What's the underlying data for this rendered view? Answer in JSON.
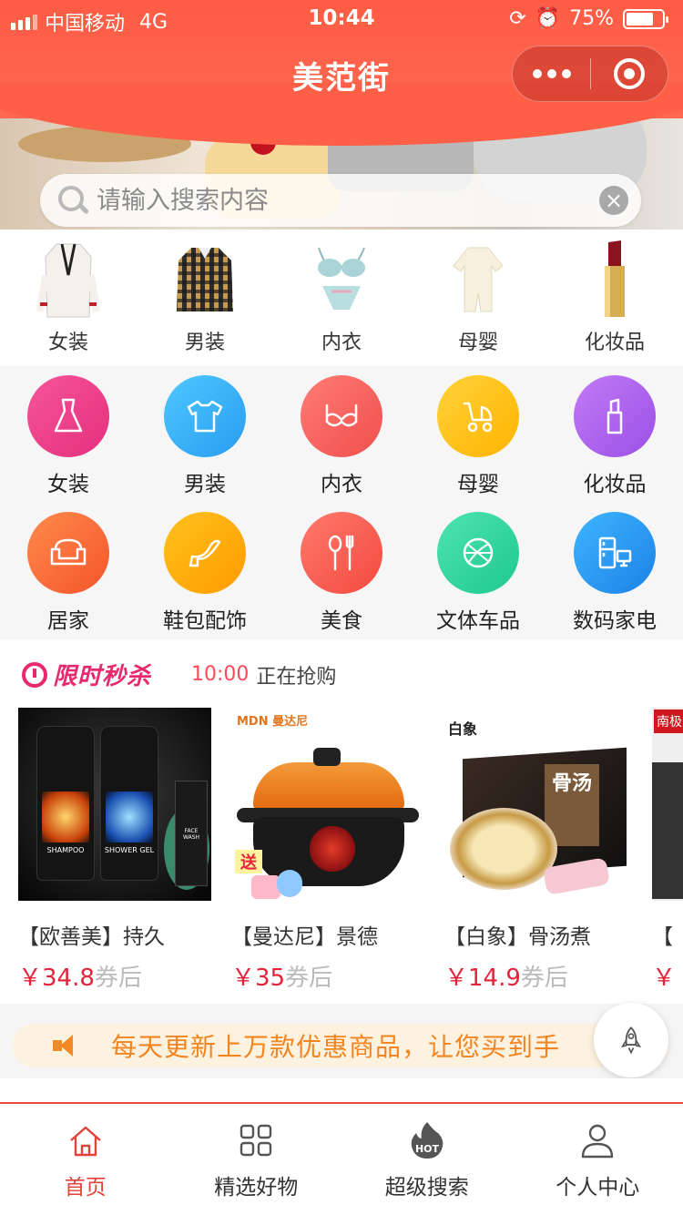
{
  "status_bar": {
    "carrier": "中国移动",
    "network": "4G",
    "time": "10:44",
    "battery": "75%",
    "battery_level": 0.75
  },
  "nav": {
    "title": "美范街"
  },
  "search": {
    "placeholder": "请输入搜索内容"
  },
  "photo_categories": [
    {
      "label": "女装",
      "icon": "coat-photo"
    },
    {
      "label": "男装",
      "icon": "plaid-shirt-photo"
    },
    {
      "label": "内衣",
      "icon": "lingerie-photo"
    },
    {
      "label": "母婴",
      "icon": "baby-romper-photo"
    },
    {
      "label": "化妆品",
      "icon": "lipstick-photo"
    }
  ],
  "icon_categories": [
    {
      "label": "女装",
      "icon": "dress-icon",
      "color_from": "#f6559a",
      "color_to": "#e42f7c"
    },
    {
      "label": "男装",
      "icon": "tshirt-icon",
      "color_from": "#4ec8ff",
      "color_to": "#2a9cf0"
    },
    {
      "label": "内衣",
      "icon": "bra-icon",
      "color_from": "#ff7b74",
      "color_to": "#f04f4d"
    },
    {
      "label": "母婴",
      "icon": "stroller-icon",
      "color_from": "#ffd23a",
      "color_to": "#ffb400"
    },
    {
      "label": "化妆品",
      "icon": "lipstick-icon",
      "color_from": "#c27bf5",
      "color_to": "#9a4fe6"
    },
    {
      "label": "居家",
      "icon": "sofa-icon",
      "color_from": "#ff8a4d",
      "color_to": "#f4552a"
    },
    {
      "label": "鞋包配饰",
      "icon": "high-heel-icon",
      "color_from": "#ffc21c",
      "color_to": "#ff9a00"
    },
    {
      "label": "美食",
      "icon": "spoon-fork-icon",
      "color_from": "#ff7a6c",
      "color_to": "#f3493f"
    },
    {
      "label": "文体车品",
      "icon": "ball-icon",
      "color_from": "#4ee3b0",
      "color_to": "#1ec98e"
    },
    {
      "label": "数码家电",
      "icon": "appliance-icon",
      "color_from": "#3fb4ff",
      "color_to": "#1b82e6"
    }
  ],
  "flash_sale": {
    "title": "限时秒杀",
    "time": "10:00",
    "status": "正在抢购",
    "products": [
      {
        "name": "【欧善美】持久",
        "price": "￥34.8",
        "coupon": "券后"
      },
      {
        "name": "【曼达尼】景德",
        "price": "￥35",
        "coupon": "券后"
      },
      {
        "name": "【白象】骨汤煮",
        "price": "￥14.9",
        "coupon": "券后"
      },
      {
        "name": "【",
        "price": "￥",
        "coupon": ""
      }
    ]
  },
  "product_art": {
    "p1_labels": [
      "SHAMPOO",
      "SHOWER GEL",
      "FACE WASH"
    ],
    "p2_brand": "MDN 曼达尼",
    "p2_badge": "送",
    "p3_brand": "白象",
    "p3_box": "骨汤",
    "p4_brand": "南极"
  },
  "notice": {
    "text": "每天更新上万款优惠商品，让您买到手"
  },
  "tabbar": [
    {
      "label": "首页",
      "icon": "home-icon",
      "active": true
    },
    {
      "label": "精选好物",
      "icon": "grid-icon",
      "active": false
    },
    {
      "label": "超级搜索",
      "icon": "hot-flame-icon",
      "active": false,
      "badge": "HOT"
    },
    {
      "label": "个人中心",
      "icon": "person-icon",
      "active": false
    }
  ],
  "colors": {
    "header_red": "#ff5e47",
    "price_red": "#e4243b",
    "accent_pink": "#e9296d",
    "notice_orange": "#f2851f"
  }
}
